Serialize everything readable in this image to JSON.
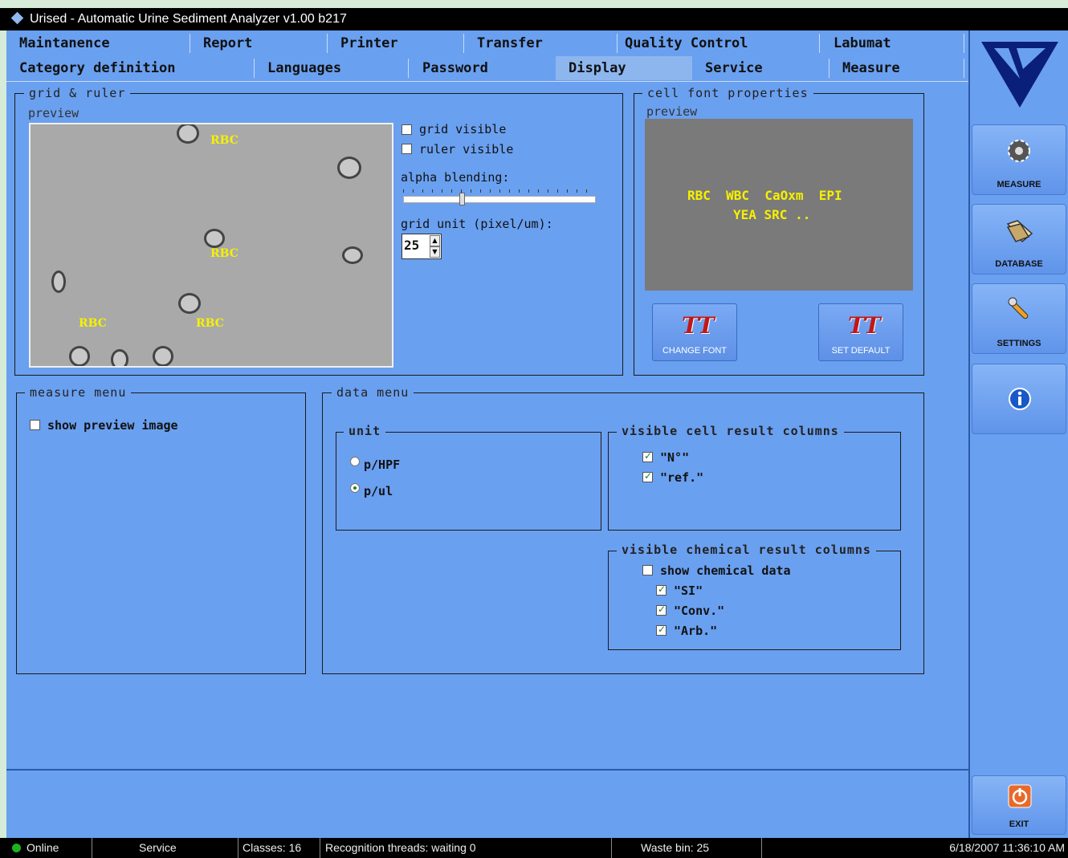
{
  "window": {
    "title": "Urised - Automatic Urine Sediment Analyzer v1.00  b217"
  },
  "tabs_row1": [
    "Maintanence",
    "Report",
    "Printer",
    "Transfer",
    "Quality Control",
    "Labumat"
  ],
  "tabs_row2": [
    "Category definition",
    "Languages",
    "Password",
    "Display",
    "Service",
    "Measure"
  ],
  "active_tab": "Display",
  "grid_ruler": {
    "title": "grid & ruler",
    "preview_label": "preview",
    "preview_cell_labels": [
      "RBC",
      "RBC",
      "RBC",
      "RBC"
    ],
    "grid_visible_label": "grid visible",
    "grid_visible": false,
    "ruler_visible_label": "ruler visible",
    "ruler_visible": false,
    "alpha_label": "alpha blending:",
    "alpha_value": 0.3,
    "grid_unit_label": "grid unit (pixel/um):",
    "grid_unit_value": "25"
  },
  "cell_font": {
    "title": "cell font properties",
    "preview_label": "preview",
    "preview_line1": "RBC  WBC  CaOxm  EPI",
    "preview_line2": "YEA SRC ..",
    "change_font_label": "CHANGE FONT",
    "set_default_label": "SET DEFAULT"
  },
  "measure_menu": {
    "title": "measure menu",
    "show_preview_label": "show preview image",
    "show_preview": false
  },
  "data_menu": {
    "title": "data menu",
    "unit": {
      "title": "unit",
      "options": [
        "p/HPF",
        "p/ul"
      ],
      "selected": "p/ul"
    },
    "cell_columns": {
      "title": "visible cell result columns",
      "items": [
        {
          "label": "\"N°\"",
          "checked": true
        },
        {
          "label": "\"ref.\"",
          "checked": true
        }
      ]
    },
    "chemical_columns": {
      "title": "visible chemical result columns",
      "show_label": "show chemical data",
      "show_checked": false,
      "items": [
        {
          "label": "\"SI\"",
          "checked": true
        },
        {
          "label": "\"Conv.\"",
          "checked": true
        },
        {
          "label": "\"Arb.\"",
          "checked": true
        }
      ]
    }
  },
  "sidebar": {
    "measure_label": "MEASURE",
    "database_label": "DATABASE",
    "settings_label": "SETTINGS",
    "exit_label": "EXIT"
  },
  "status": {
    "online": "Online",
    "mode": "Service",
    "classes": "Classes: 16",
    "threads": "Recognition threads: waiting 0",
    "waste": "Waste bin: 25",
    "datetime": "6/18/2007 11:36:10 AM"
  },
  "colors": {
    "background": "#6aa0f0",
    "label_yellow": "#f6f000",
    "online_green": "#1db31d"
  }
}
